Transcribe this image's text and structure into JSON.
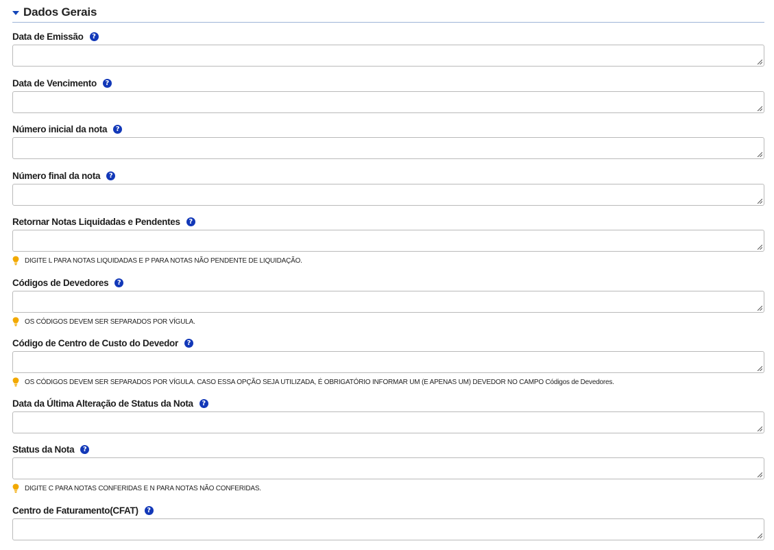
{
  "section": {
    "title": "Dados Gerais"
  },
  "help_icon_glyph": "?",
  "fields": [
    {
      "label": "Data de Emissão",
      "value": "",
      "hint": ""
    },
    {
      "label": "Data de Vencimento",
      "value": "",
      "hint": ""
    },
    {
      "label": "Número inicial da nota",
      "value": "",
      "hint": ""
    },
    {
      "label": "Número final da nota",
      "value": "",
      "hint": ""
    },
    {
      "label": "Retornar Notas Liquidadas e Pendentes",
      "value": "",
      "hint": "DIGITE L PARA NOTAS LIQUIDADAS E P PARA NOTAS NÃO PENDENTE DE LIQUIDAÇÃO."
    },
    {
      "label": "Códigos de Devedores",
      "value": "",
      "hint": "OS CÓDIGOS DEVEM SER SEPARADOS POR VÍGULA."
    },
    {
      "label": "Código de Centro de Custo do Devedor",
      "value": "",
      "hint": "OS CÓDIGOS DEVEM SER SEPARADOS POR VÍGULA. CASO ESSA OPÇÃO SEJA UTILIZADA, É OBRIGATÓRIO INFORMAR UM (E APENAS UM) DEVEDOR NO CAMPO Códigos de Devedores."
    },
    {
      "label": "Data da Última Alteração de Status da Nota",
      "value": "",
      "hint": ""
    },
    {
      "label": "Status da Nota",
      "value": "",
      "hint": "DIGITE C PARA NOTAS CONFERIDAS E N PARA NOTAS NÃO CONFERIDAS."
    },
    {
      "label": "Centro de Faturamento(CFAT)",
      "value": "",
      "hint": ""
    }
  ],
  "icons": {
    "section_toggle": "caret-down-icon",
    "help": "question-circle-icon",
    "hint": "lightbulb-icon",
    "resize": "resize-grip-icon"
  },
  "colors": {
    "accent": "#1238b8",
    "hint_icon": "#f2a900",
    "divider": "#9db4d6",
    "input_border": "#b9b9b9"
  }
}
